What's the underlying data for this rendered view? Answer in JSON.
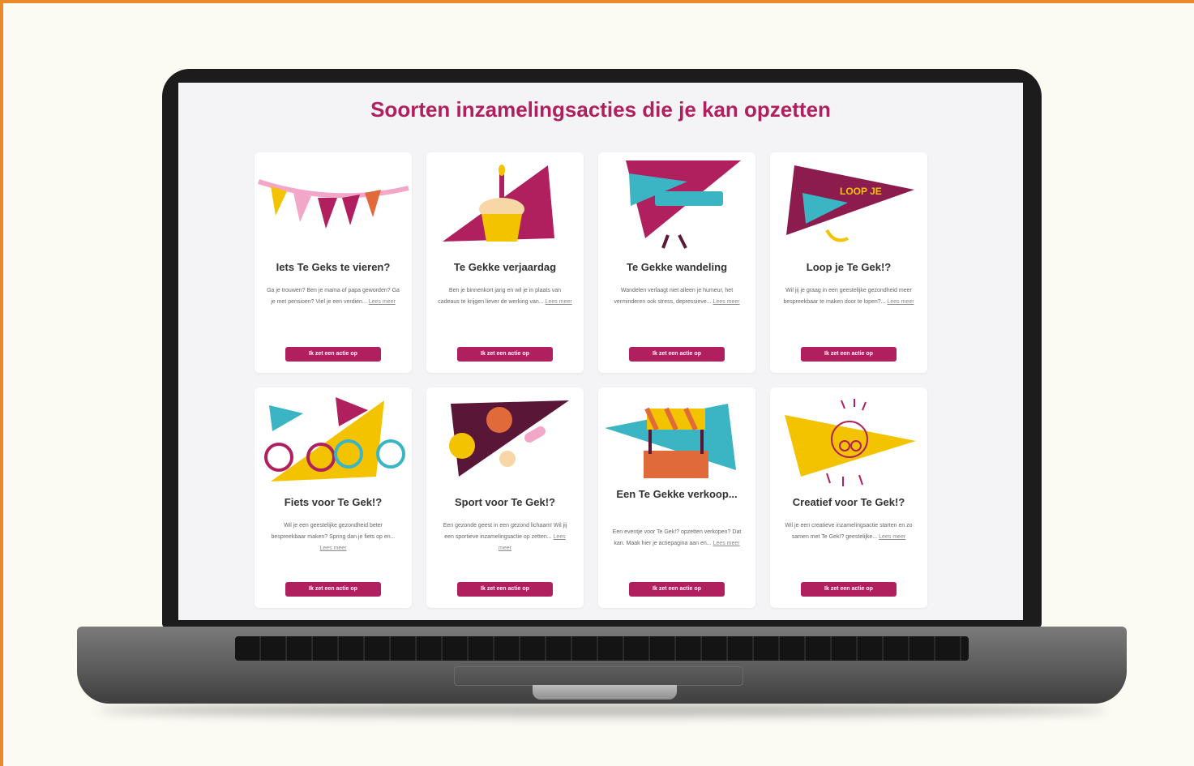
{
  "page": {
    "title": "Soorten inzamelingsacties die je kan opzetten"
  },
  "colors": {
    "accent": "#b0205e",
    "frame": "#e9892a",
    "background": "#fbfaf3"
  },
  "cards": [
    {
      "title": "Iets Te Geks te vieren?",
      "description": "Ga je trouwen? Ben je mama of papa geworden? Ga je met pensioen? Viel je een verdien...",
      "more": "Lees meer",
      "button": "Ik zet een actie op",
      "icon": "bunting-icon"
    },
    {
      "title": "Te Gekke verjaardag",
      "description": "Ben je binnenkort jarig en wil je in plaats van cadeaus te krijgen liever de werking van...",
      "more": "Lees meer",
      "button": "Ik zet een actie op",
      "icon": "cupcake-icon"
    },
    {
      "title": "Te Gekke wandeling",
      "description": "Wandelen verlaagt niet alleen je humeur, het verminderen ook stress, depressieve...",
      "more": "Lees meer",
      "button": "Ik zet een actie op",
      "icon": "walking-flag-icon"
    },
    {
      "title": "Loop je Te Gek!?",
      "description": "Wil jij je graag in een geestelijke gezondheid meer bespreekbaar te maken door te lopen?...",
      "more": "Lees meer",
      "button": "Ik zet een actie op",
      "icon": "running-flag-icon"
    },
    {
      "title": "Fiets voor Te Gek!?",
      "description": "Wil je een geestelijke gezondheid beter bespreekbaar maken? Spring dan je fiets op en...",
      "more": "Lees meer",
      "button": "Ik zet een actie op",
      "icon": "bicycle-icon"
    },
    {
      "title": "Sport voor Te Gek!?",
      "description": "Een gezonde geest in een gezond lichaam! Wil jij een sportieve inzamelingsactie op zetten...",
      "more": "Lees meer",
      "button": "Ik zet een actie op",
      "icon": "sports-balls-icon"
    },
    {
      "title": "Een Te Gekke verkoop...",
      "description": "Een eventje voor Te Gek!? opzetten verkopen? Dat kan. Maak hier je actiepagina aan en...",
      "more": "Lees meer",
      "button": "Ik zet een actie op",
      "icon": "market-stall-icon"
    },
    {
      "title": "Creatief voor Te Gek!?",
      "description": "Wil je een creatieve inzamelingsactie starten en zo samen met Te Gek!? geestelijke...",
      "more": "Lees meer",
      "button": "Ik zet een actie op",
      "icon": "creative-drawing-icon"
    }
  ]
}
